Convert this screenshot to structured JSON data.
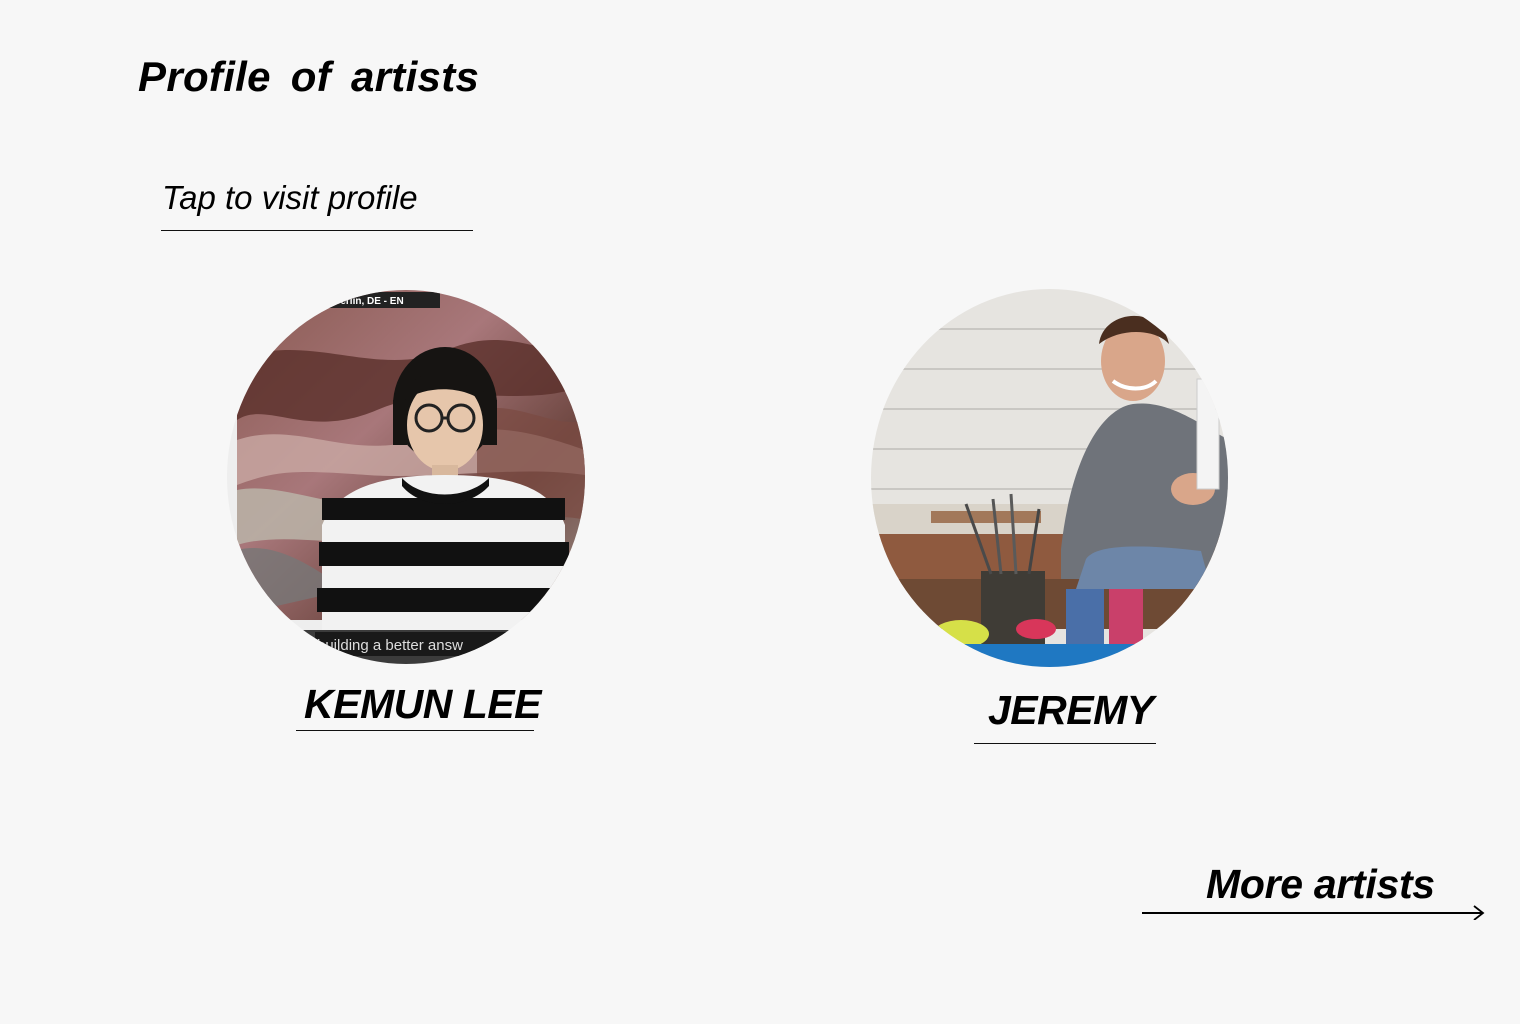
{
  "page": {
    "title": "Profile  of  artists",
    "subtitle": "Tap to visit profile"
  },
  "artists": [
    {
      "name": "KEMUN LEE",
      "photo_caption_top": "s, Berlin, DE - EN",
      "photo_caption_bottom": "building a better answ"
    },
    {
      "name": "JEREMY"
    }
  ],
  "more_link": {
    "label": "More artists"
  },
  "icons": {
    "more_arrow": "arrow-right-icon"
  },
  "colors": {
    "background": "#f7f7f7",
    "text": "#000000"
  }
}
